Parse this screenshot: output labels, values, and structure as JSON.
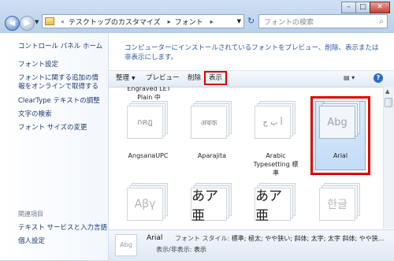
{
  "window": {
    "address": [
      "テスクトップのカスタマイズ",
      "フォント"
    ],
    "search_placeholder": "フォントの検索",
    "controls": {
      "min": "–",
      "max": "□",
      "close": "✕"
    }
  },
  "sidebar": {
    "items": [
      {
        "label": "コントロール パネル ホーム"
      },
      {
        "label": "フォント設定"
      },
      {
        "label": "フォントに関する追加の情報をオンラインで取得する"
      },
      {
        "label": "ClearType テキストの調整"
      },
      {
        "label": "文字の検索"
      },
      {
        "label": "フォント サイズの変更"
      }
    ],
    "related_heading": "関連項目",
    "related": [
      {
        "label": "テキスト サービスと入力言語"
      },
      {
        "label": "個人設定"
      }
    ]
  },
  "main": {
    "description": "コンピューターにインストールされているフォントをプレビュー、削除、表示または非表示にします。",
    "toolbar": {
      "organize": "整理",
      "preview": "プレビュー",
      "delete": "削除",
      "show": "表示"
    },
    "partial_label": "Engraved LET Plain 中",
    "fonts_row1": [
      {
        "name": "AngsanaUPC",
        "sample": "กคฎ"
      },
      {
        "name": "Aparajita",
        "sample": "अबक"
      },
      {
        "name": "Arabic Typesetting 標準",
        "sample": "أ ب ج"
      },
      {
        "name": "Arial",
        "sample": "Abg"
      }
    ],
    "fonts_row2": [
      {
        "sample": "Αβγ"
      },
      {
        "sample": "あア亜"
      },
      {
        "sample": "あア亜"
      },
      {
        "sample": "한글"
      }
    ]
  },
  "details": {
    "thumb": "Abg",
    "name": "Arial",
    "style_label": "フォント スタイル:",
    "style_value": "標準; 極太; やや狭い; 斜体; 太字; 太字 斜体; やや狭...",
    "visibility_label": "表示/非表示:",
    "visibility_value": "表示"
  }
}
